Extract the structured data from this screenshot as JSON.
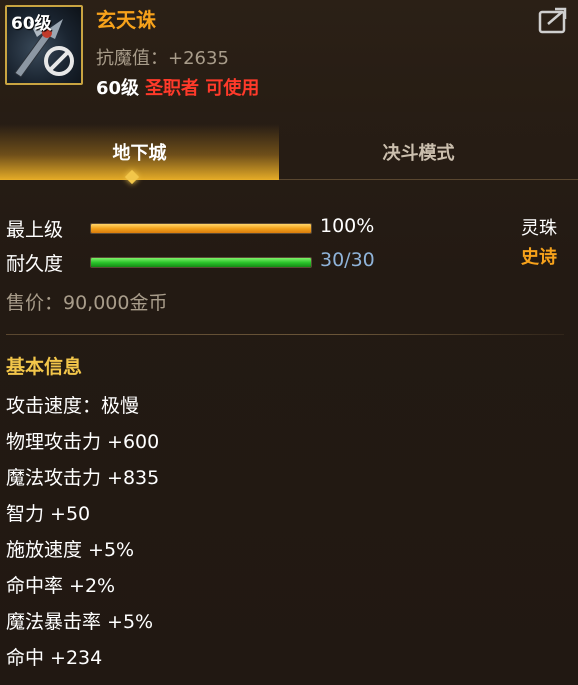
{
  "item": {
    "level_badge": "60级",
    "name": "玄天诛",
    "anti_magic": "抗魔值：+2635",
    "req_level": "60级",
    "req_class": "圣职者 可使用"
  },
  "tabs": [
    {
      "label": "地下城",
      "active": true
    },
    {
      "label": "决斗模式",
      "active": false
    }
  ],
  "stats": {
    "grade_label": "最上级",
    "grade_value": "100%",
    "grade_fill": 1.0,
    "durability_label": "耐久度",
    "durability_value": "30/30",
    "durability_fill": 1.0,
    "price": "售价：90,000金币"
  },
  "side_tags": {
    "type": "灵珠",
    "rarity": "史诗"
  },
  "section_title": "基本信息",
  "attributes": [
    "攻击速度：极慢",
    "物理攻击力 +600",
    "魔法攻击力 +835",
    "智力 +50",
    "施放速度 +5%",
    "命中率 +2%",
    "魔法暴击率 +5%",
    "命中 +234"
  ],
  "colors": {
    "name": "#f7a21b",
    "class_req": "#ff3a2a",
    "rarity": "#f7a21b",
    "section_title": "#f2c64a",
    "durability_value": "#8fb3d9"
  }
}
